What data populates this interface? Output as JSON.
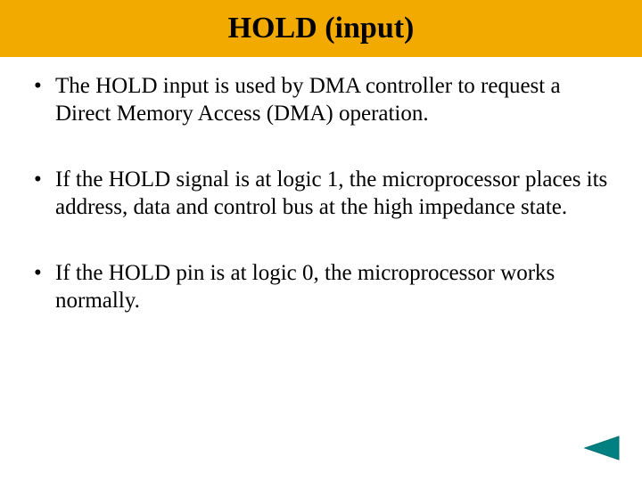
{
  "title": "HOLD (input)",
  "bullets": [
    "The HOLD input is used by DMA controller to request a Direct Memory Access (DMA) operation.",
    "If the HOLD signal is at logic 1, the microprocessor places its address, data and control bus at the high impedance state.",
    "If the HOLD pin is at logic 0, the microprocessor works normally."
  ],
  "colors": {
    "title_band": "#f2a900",
    "nav_fill": "#008080",
    "nav_stroke": "#007070"
  },
  "icons": {
    "nav_back": "back-triangle-icon"
  }
}
